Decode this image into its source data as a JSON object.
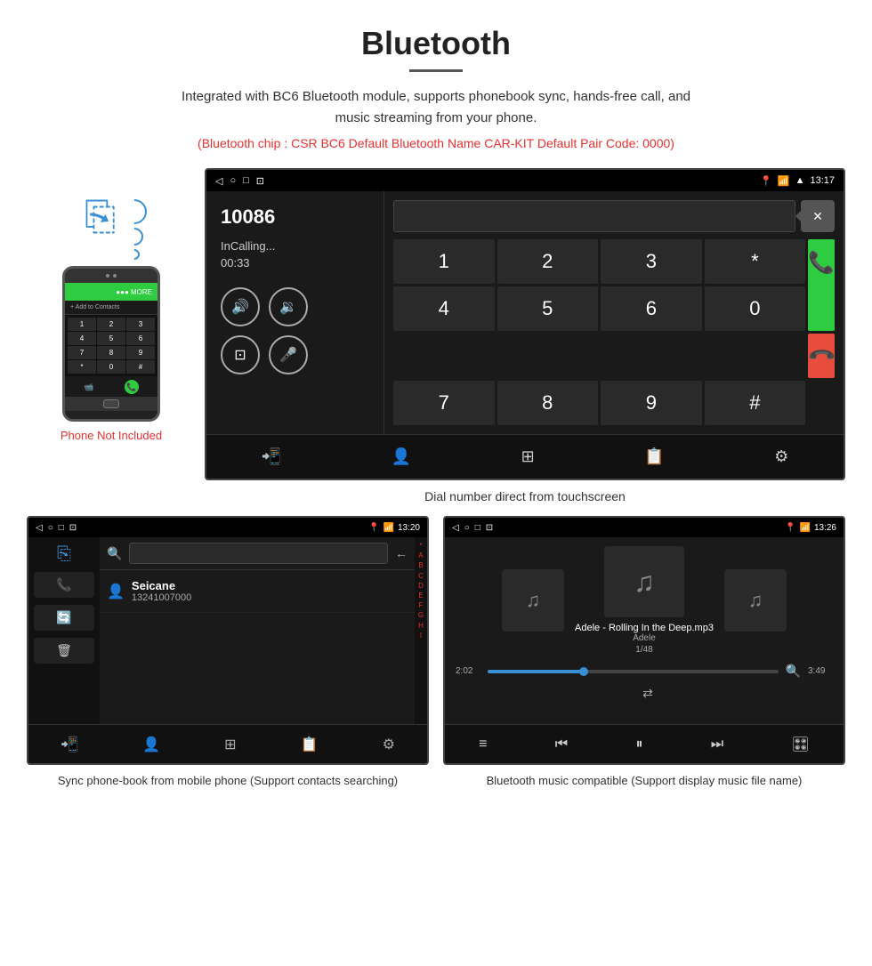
{
  "header": {
    "title": "Bluetooth",
    "description": "Integrated with BC6 Bluetooth module, supports phonebook sync, hands-free call, and music streaming from your phone.",
    "specs": "(Bluetooth chip : CSR BC6    Default Bluetooth Name CAR-KIT    Default Pair Code: 0000)"
  },
  "phone_mockup": {
    "not_included_label": "Phone Not Included",
    "add_contacts_label": "+ Add to Contacts",
    "dialpad_keys": [
      "1",
      "2",
      "3",
      "4",
      "5",
      "6",
      "7",
      "8",
      "9",
      "*",
      "0",
      "#"
    ]
  },
  "car_screen_call": {
    "status_bar": {
      "left_icons": [
        "◁",
        "○",
        "□",
        "⊡"
      ],
      "right_text": "13:17",
      "right_icons": [
        "📍",
        "📞",
        "▲"
      ]
    },
    "call_number": "10086",
    "call_status": "InCalling...",
    "call_timer": "00:33",
    "dialpad_keys": [
      "1",
      "2",
      "3",
      "*",
      "4",
      "5",
      "6",
      "0",
      "7",
      "8",
      "9",
      "#"
    ],
    "green_btn_label": "📞",
    "red_btn_label": "📞"
  },
  "screen_caption": "Dial number direct from touchscreen",
  "phonebook_screen": {
    "status_bar": {
      "left_icons": [
        "◁",
        "○",
        "□",
        "⊡"
      ],
      "right_text": "13:20"
    },
    "contact_name": "Seicane",
    "contact_number": "13241007000",
    "alphabet_letters": [
      "*",
      "A",
      "B",
      "C",
      "D",
      "E",
      "F",
      "G",
      "H",
      "I"
    ]
  },
  "music_screen": {
    "status_bar": {
      "right_text": "13:26"
    },
    "song_title": "Adele - Rolling In the Deep.mp3",
    "artist": "Adele",
    "track_count": "1/48",
    "current_time": "2:02",
    "total_time": "3:49",
    "progress_pct": 33
  },
  "captions": {
    "phonebook": "Sync phone-book from mobile phone\n(Support contacts searching)",
    "music": "Bluetooth music compatible\n(Support display music file name)"
  },
  "colors": {
    "accent_red": "#e83030",
    "accent_blue": "#3a8fd4",
    "accent_green": "#2ecc40"
  }
}
